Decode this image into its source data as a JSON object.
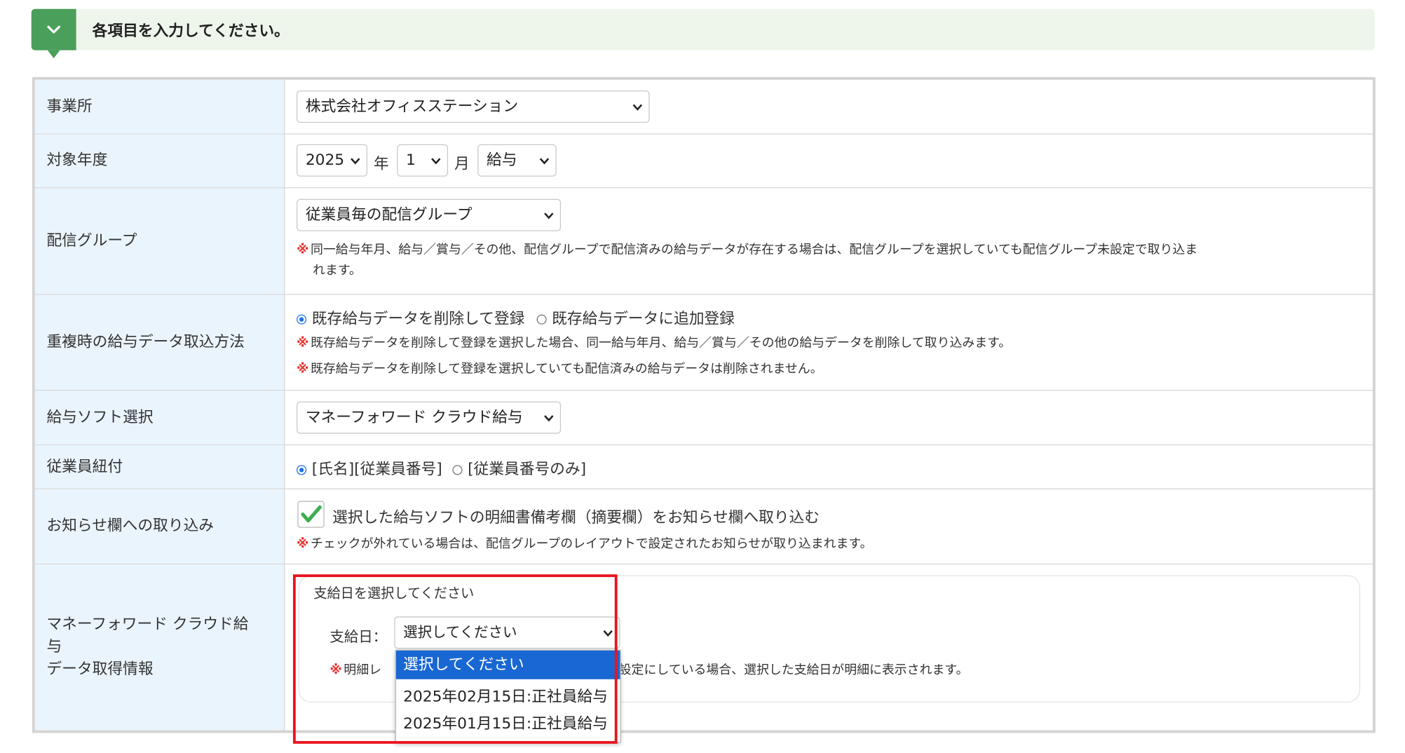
{
  "banner": {
    "title": "各項目を入力してください。",
    "icon": "chevron-down-icon",
    "color": "#4a9f5b"
  },
  "rows": {
    "office": {
      "label": "事業所",
      "value": "株式会社オフィスステーション"
    },
    "year": {
      "label": "対象年度",
      "year_value": "2025",
      "year_unit": "年",
      "month_value": "1",
      "month_unit": "月",
      "type_value": "給与"
    },
    "group": {
      "label": "配信グループ",
      "value": "従業員毎の配信グループ",
      "note_line1": "同一給与年月、給与／賞与／その他、配信グループで配信済みの給与データが存在する場合は、配信グループを選択していても配信グループ未設定で取り込ま",
      "note_line2": "れます。"
    },
    "duplicate": {
      "label": "重複時の給与データ取込方法",
      "option1": "既存給与データを削除して登録",
      "option2": "既存給与データに追加登録",
      "selected": "既存給与データを削除して登録",
      "note1": "既存給与データを削除して登録を選択した場合、同一給与年月、給与／賞与／その他の給与データを削除して取り込みます。",
      "note2": "既存給与データを削除して登録を選択していても配信済みの給与データは削除されません。"
    },
    "software": {
      "label": "給与ソフト選択",
      "value": "マネーフォワード クラウド給与"
    },
    "employee": {
      "label": "従業員紐付",
      "option1": "[氏名][従業員番号]",
      "option2": "[従業員番号のみ]",
      "selected": "[氏名][従業員番号]"
    },
    "notice": {
      "label": "お知らせ欄への取り込み",
      "checkbox_label": "選択した給与ソフトの明細書備考欄（摘要欄）をお知らせ欄へ取り込む",
      "checked": true,
      "note": "チェックが外れている場合は、配信グループのレイアウトで設定されたお知らせが取り込まれます。"
    },
    "mf_info": {
      "label_line1": "マネーフォワード クラウド給",
      "label_line2": "与",
      "label_line3": "データ取得情報",
      "heading": "支給日を選択してください",
      "field_label": "支給日：",
      "select_value": "選択してください",
      "note_start": "明細レ",
      "note_end": "示する設定にしている場合、選択した支給日が明細に表示されます。"
    }
  },
  "dropdown": {
    "options": [
      "選択してください",
      "2025年02月15日:正社員給与",
      "2025年01月15日:正社員給与"
    ],
    "highlighted_index": 0
  },
  "colors": {
    "label_bg": "#eaf4fd",
    "accent_red": "#e8141e",
    "selected_option": "#1967d2"
  },
  "kome": "※"
}
